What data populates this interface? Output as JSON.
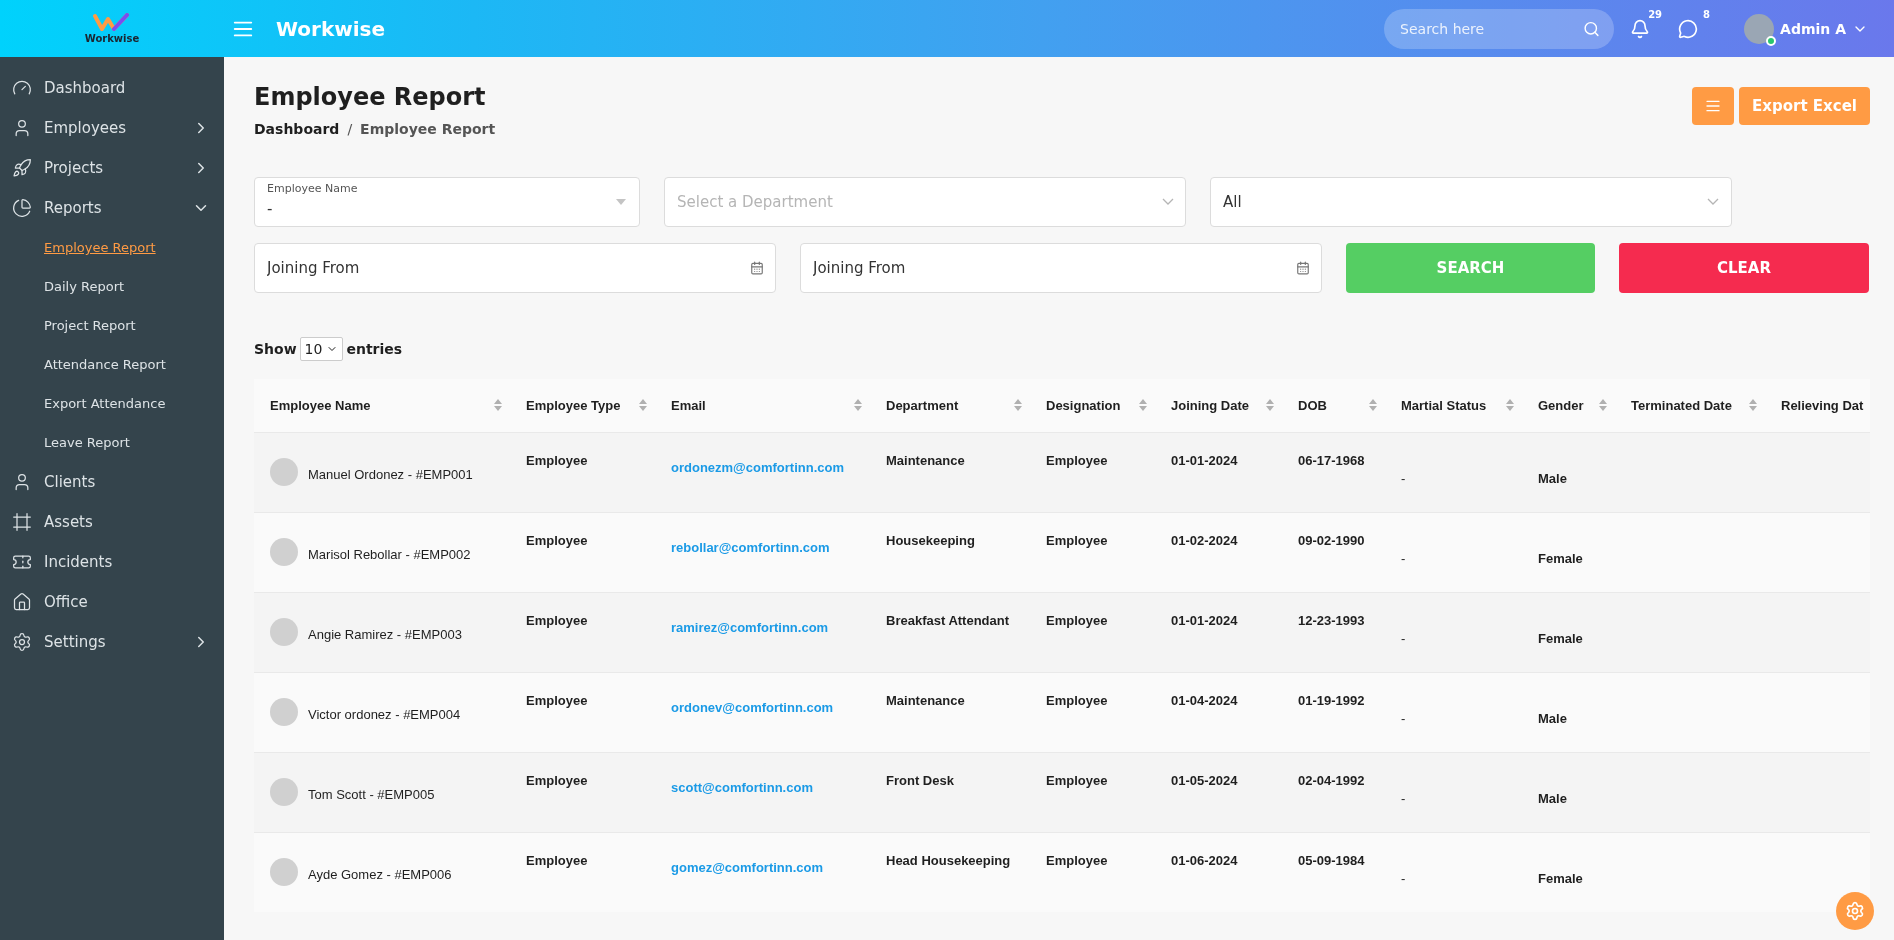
{
  "header": {
    "logo_text": "Workwise",
    "app_title": "Workwise",
    "search": {
      "placeholder": "Search here"
    },
    "notifications": {
      "count": "29"
    },
    "messages": {
      "count": "8"
    },
    "user": {
      "name": "Admin A",
      "online": true
    }
  },
  "sidebar": {
    "items": [
      {
        "label": "Dashboard"
      },
      {
        "label": "Employees",
        "expanded": false
      },
      {
        "label": "Projects",
        "expanded": false
      },
      {
        "label": "Reports",
        "expanded": true,
        "children": [
          {
            "label": "Employee Report",
            "selected": true
          },
          {
            "label": "Daily Report",
            "selected": false
          },
          {
            "label": "Project Report",
            "selected": false
          },
          {
            "label": "Attendance Report",
            "selected": false
          },
          {
            "label": "Export Attendance",
            "selected": false
          },
          {
            "label": "Leave Report",
            "selected": false
          }
        ]
      },
      {
        "label": "Clients"
      },
      {
        "label": "Assets"
      },
      {
        "label": "Incidents"
      },
      {
        "label": "Office"
      },
      {
        "label": "Settings",
        "expanded": false
      }
    ]
  },
  "page": {
    "title": "Employee Report",
    "breadcrumb_separator": "/",
    "breadcrumb": [
      {
        "label": "Dashboard"
      },
      {
        "label": "Employee Report"
      }
    ],
    "export_button": "Export Excel"
  },
  "filters": {
    "employee_name": {
      "label": "Employee Name",
      "value": "-"
    },
    "department": {
      "placeholder": "Select a Department"
    },
    "status": {
      "value": "All"
    },
    "joining": [
      {
        "placeholder": "Joining From"
      },
      {
        "placeholder": "Joining From"
      }
    ],
    "search_button": "SEARCH",
    "clear_button": "CLEAR"
  },
  "entries": {
    "prefix": "Show",
    "value": "10",
    "suffix": "entries"
  },
  "table": {
    "columns": [
      "Employee Name",
      "Employee Type",
      "Email",
      "Department",
      "Designation",
      "Joining Date",
      "DOB",
      "Martial Status",
      "Gender",
      "Terminated Date",
      "Relieving Dat"
    ],
    "rows": [
      {
        "name": "Manuel Ordonez - #EMP001",
        "type": "Employee",
        "email": "ordonezm@comfortinn.com",
        "department": "Maintenance",
        "designation": "Employee",
        "joining_date": "01-01-2024",
        "dob": "06-17-1968",
        "marital_status": "-",
        "gender": "Male"
      },
      {
        "name": "Marisol Rebollar - #EMP002",
        "type": "Employee",
        "email": "rebollar@comfortinn.com",
        "department": "Housekeeping",
        "designation": "Employee",
        "joining_date": "01-02-2024",
        "dob": "09-02-1990",
        "marital_status": "-",
        "gender": "Female"
      },
      {
        "name": "Angie Ramirez - #EMP003",
        "type": "Employee",
        "email": "ramirez@comfortinn.com",
        "department": "Breakfast Attendant",
        "designation": "Employee",
        "joining_date": "01-01-2024",
        "dob": "12-23-1993",
        "marital_status": "-",
        "gender": "Female"
      },
      {
        "name": "Victor ordonez - #EMP004",
        "type": "Employee",
        "email": "ordonev@comfortinn.com",
        "department": "Maintenance",
        "designation": "Employee",
        "joining_date": "01-04-2024",
        "dob": "01-19-1992",
        "marital_status": "-",
        "gender": "Male"
      },
      {
        "name": "Tom Scott - #EMP005",
        "type": "Employee",
        "email": "scott@comfortinn.com",
        "department": "Front Desk",
        "designation": "Employee",
        "joining_date": "01-05-2024",
        "dob": "02-04-1992",
        "marital_status": "-",
        "gender": "Male"
      },
      {
        "name": "Ayde Gomez - #EMP006",
        "type": "Employee",
        "email": "gomez@comfortinn.com",
        "department": "Head Housekeeping",
        "designation": "Employee",
        "joining_date": "01-06-2024",
        "dob": "05-09-1984",
        "marital_status": "-",
        "gender": "Female"
      }
    ]
  }
}
